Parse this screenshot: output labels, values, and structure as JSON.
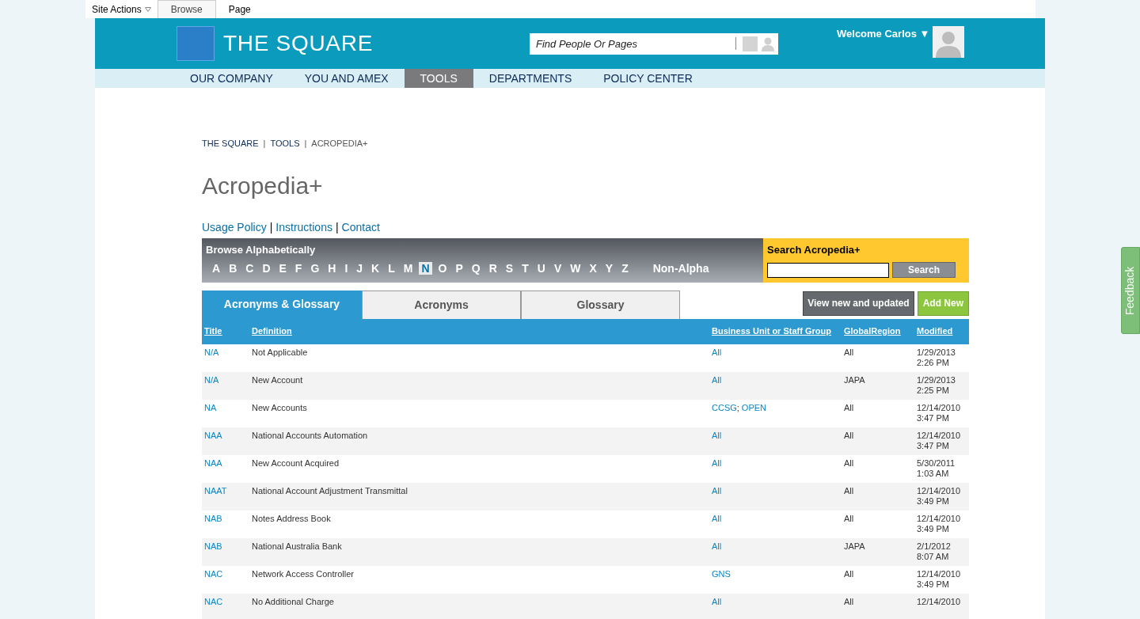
{
  "ribbon": {
    "site_actions": "Site Actions",
    "tabs": [
      {
        "label": "Browse",
        "selected": true
      },
      {
        "label": "Page",
        "selected": false
      }
    ]
  },
  "header": {
    "logo_text": "THE SQUARE",
    "search": {
      "placeholder": "Find People Or Pages"
    },
    "welcome": "Welcome Carlos ▼"
  },
  "nav": [
    {
      "label": "OUR COMPANY",
      "selected": false
    },
    {
      "label": "YOU AND AMEX",
      "selected": false
    },
    {
      "label": "TOOLS",
      "selected": true
    },
    {
      "label": "DEPARTMENTS",
      "selected": false
    },
    {
      "label": "POLICY CENTER",
      "selected": false
    }
  ],
  "breadcrumb_separator": "|",
  "links_separator": "|",
  "units_separator": ";",
  "breadcrumb": [
    {
      "label": "THE SQUARE",
      "kind": "link"
    },
    {
      "label": "TOOLS",
      "kind": "link"
    },
    {
      "label": "ACROPEDIA+",
      "kind": "current"
    }
  ],
  "page_title": "Acropedia+",
  "links": [
    "Usage Policy",
    "Instructions",
    "Contact"
  ],
  "browse": {
    "title": "Browse Alphabetically",
    "letters": [
      {
        "label": "A",
        "selected": false
      },
      {
        "label": "B",
        "selected": false
      },
      {
        "label": "C",
        "selected": false
      },
      {
        "label": "D",
        "selected": false
      },
      {
        "label": "E",
        "selected": false
      },
      {
        "label": "F",
        "selected": false
      },
      {
        "label": "G",
        "selected": false
      },
      {
        "label": "H",
        "selected": false
      },
      {
        "label": "I",
        "selected": false
      },
      {
        "label": "J",
        "selected": false
      },
      {
        "label": "K",
        "selected": false
      },
      {
        "label": "L",
        "selected": false
      },
      {
        "label": "M",
        "selected": false
      },
      {
        "label": "N",
        "selected": true
      },
      {
        "label": "O",
        "selected": false
      },
      {
        "label": "P",
        "selected": false
      },
      {
        "label": "Q",
        "selected": false
      },
      {
        "label": "R",
        "selected": false
      },
      {
        "label": "S",
        "selected": false
      },
      {
        "label": "T",
        "selected": false
      },
      {
        "label": "U",
        "selected": false
      },
      {
        "label": "V",
        "selected": false
      },
      {
        "label": "W",
        "selected": false
      },
      {
        "label": "X",
        "selected": false
      },
      {
        "label": "Y",
        "selected": false
      },
      {
        "label": "Z",
        "selected": false
      },
      {
        "label": "Non-Alpha",
        "selected": false
      }
    ]
  },
  "search_box": {
    "title": "Search Acropedia+",
    "button": "Search"
  },
  "tabs": [
    {
      "label": "Acronyms & Glossary",
      "selected": true
    },
    {
      "label": "Acronyms",
      "selected": false
    },
    {
      "label": "Glossary",
      "selected": false
    }
  ],
  "buttons": [
    {
      "label": "View new and updated",
      "kind": "secondary"
    },
    {
      "label": "Add New",
      "kind": "primary"
    }
  ],
  "table": {
    "columns": [
      "Title",
      "Definition",
      "Business Unit or Staff Group",
      "GlobalRegion",
      "Modified"
    ],
    "rows": [
      {
        "title": "N/A",
        "definition": "Not Applicable",
        "units": [
          "All"
        ],
        "region": "All",
        "date": "1/29/2013",
        "time": "2:26 PM"
      },
      {
        "title": "N/A",
        "definition": "New Account",
        "units": [
          "All"
        ],
        "region": "JAPA",
        "date": "1/29/2013",
        "time": "2:25 PM"
      },
      {
        "title": "NA",
        "definition": "New Accounts",
        "units": [
          "CCSG",
          "OPEN"
        ],
        "region": "All",
        "date": "12/14/2010",
        "time": "3:47 PM"
      },
      {
        "title": "NAA",
        "definition": "National Accounts Automation",
        "units": [
          "All"
        ],
        "region": "All",
        "date": "12/14/2010",
        "time": "3:47 PM"
      },
      {
        "title": "NAA",
        "definition": "New Account Acquired",
        "units": [
          "All"
        ],
        "region": "All",
        "date": "5/30/2011",
        "time": "1:03 AM"
      },
      {
        "title": "NAAT",
        "definition": "National Account Adjustment Transmittal",
        "units": [
          "All"
        ],
        "region": "All",
        "date": "12/14/2010",
        "time": "3:49 PM"
      },
      {
        "title": "NAB",
        "definition": "Notes Address Book",
        "units": [
          "All"
        ],
        "region": "All",
        "date": "12/14/2010",
        "time": "3:49 PM"
      },
      {
        "title": "NAB",
        "definition": "National Australia Bank",
        "units": [
          "All"
        ],
        "region": "JAPA",
        "date": "2/1/2012",
        "time": "8:07 AM"
      },
      {
        "title": "NAC",
        "definition": "Network Access Controller",
        "units": [
          "GNS"
        ],
        "region": "All",
        "date": "12/14/2010",
        "time": "3:49 PM"
      },
      {
        "title": "NAC",
        "definition": "No Additional Charge",
        "units": [
          "All"
        ],
        "region": "All",
        "date": "12/14/2010"
      }
    ]
  },
  "feedback": "Feedback"
}
